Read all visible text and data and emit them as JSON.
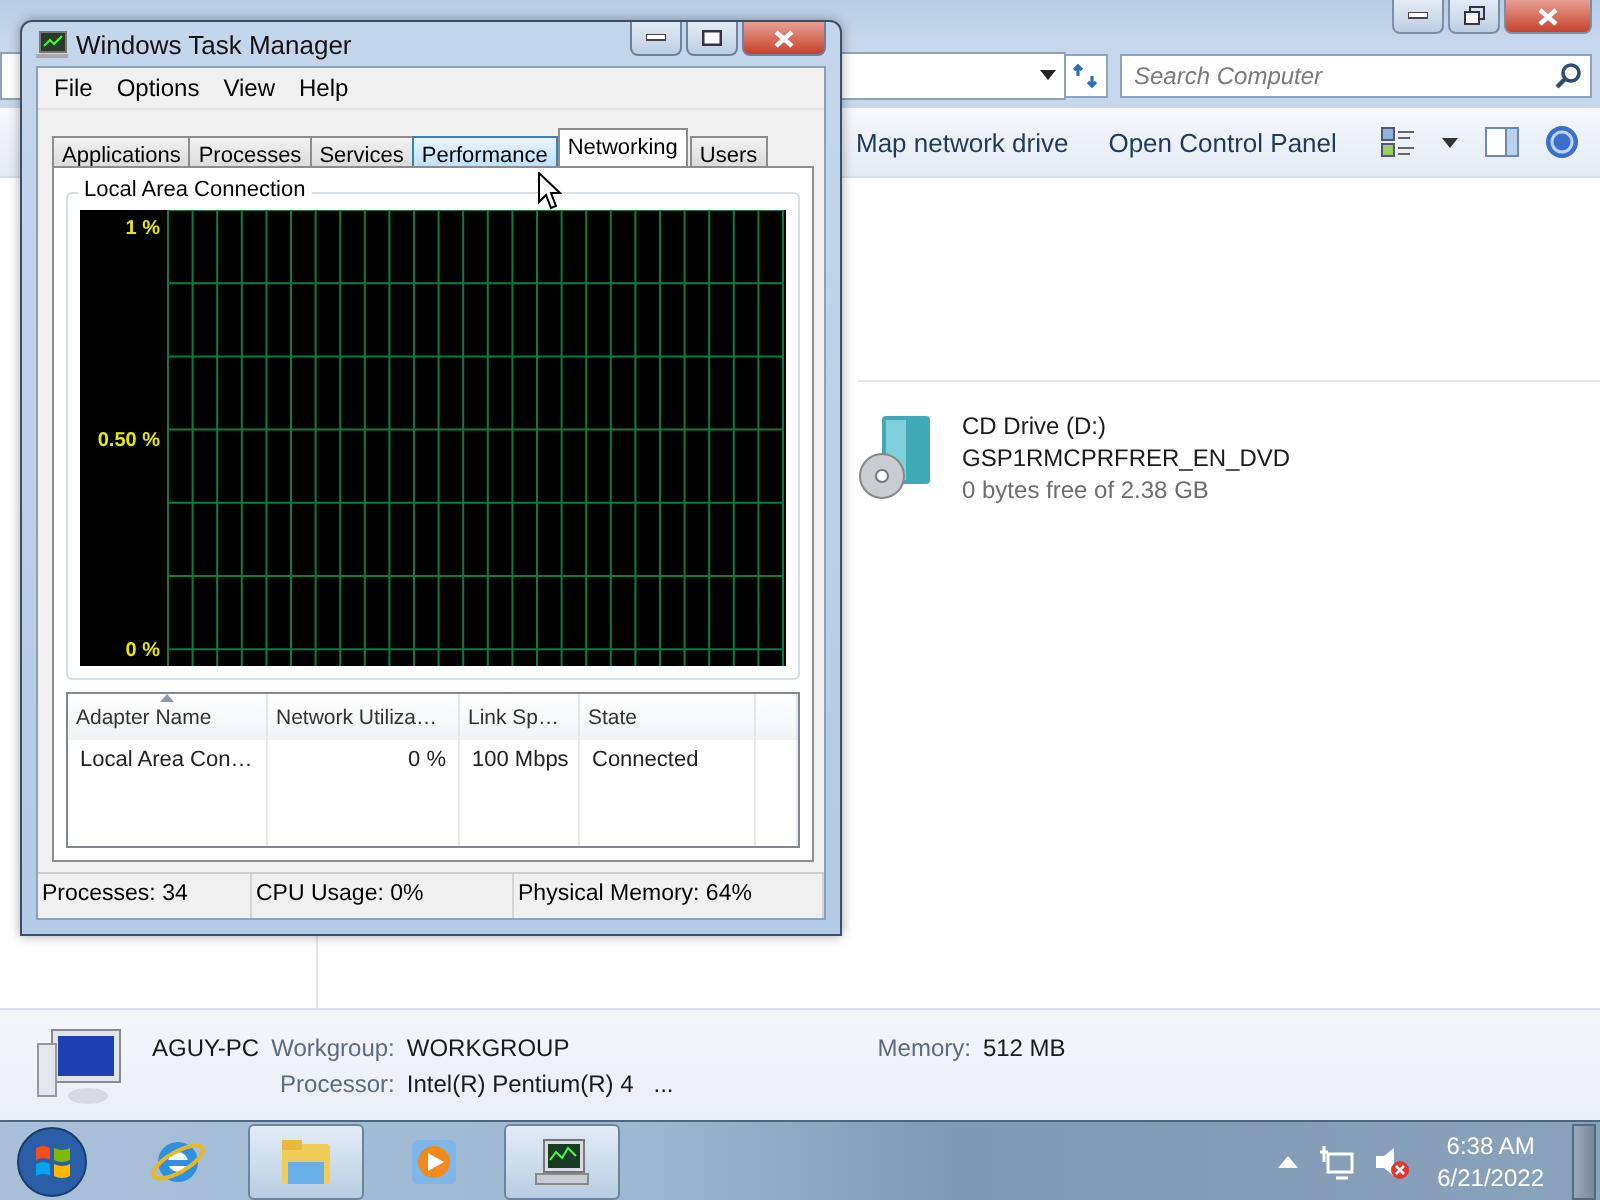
{
  "explorer": {
    "search": {
      "placeholder": "Search Computer"
    },
    "toolbar": [
      "Map network drive",
      "Open Control Panel"
    ],
    "drives": [
      {
        "name": "CD Drive (D:)",
        "label": "GSP1RMCPRFRER_EN_DVD",
        "space": "0 bytes free of 2.38 GB"
      }
    ],
    "details": {
      "computer_name": "AGUY-PC",
      "workgroup_label": "Workgroup:",
      "workgroup": "WORKGROUP",
      "memory_label": "Memory:",
      "memory": "512 MB",
      "processor_label": "Processor:",
      "processor": "Intel(R) Pentium(R) 4",
      "processor_more": "..."
    }
  },
  "task_manager": {
    "title": "Windows Task Manager",
    "menu": [
      "File",
      "Options",
      "View",
      "Help"
    ],
    "tabs": [
      {
        "label": "Applications",
        "selected": false,
        "hovered": false
      },
      {
        "label": "Processes",
        "selected": false,
        "hovered": false
      },
      {
        "label": "Services",
        "selected": false,
        "hovered": false
      },
      {
        "label": "Performance",
        "selected": false,
        "hovered": true
      },
      {
        "label": "Networking",
        "selected": true,
        "hovered": false
      },
      {
        "label": "Users",
        "selected": false,
        "hovered": false
      }
    ],
    "group_title": "Local Area Connection",
    "graph_labels": [
      "1 %",
      "0.50 %",
      "0 %"
    ],
    "table": {
      "columns": [
        {
          "label": "Adapter Name",
          "sorted": true
        },
        {
          "label": "Network Utiliza…",
          "sorted": false
        },
        {
          "label": "Link Sp…",
          "sorted": false
        },
        {
          "label": "State",
          "sorted": false
        }
      ],
      "rows": [
        [
          "Local Area Con…",
          "0 %",
          "100 Mbps",
          "Connected"
        ]
      ]
    },
    "status_bar": [
      "Processes: 34",
      "CPU Usage: 0%",
      "Physical Memory: 64%"
    ]
  },
  "taskbar": {
    "apps": [
      {
        "kind": "browser",
        "active": false
      },
      {
        "kind": "folder",
        "active": true
      },
      {
        "kind": "media",
        "active": false
      },
      {
        "kind": "monitor",
        "active": true
      }
    ],
    "clock": {
      "time": "6:38 AM",
      "date": "6/21/2022"
    }
  }
}
